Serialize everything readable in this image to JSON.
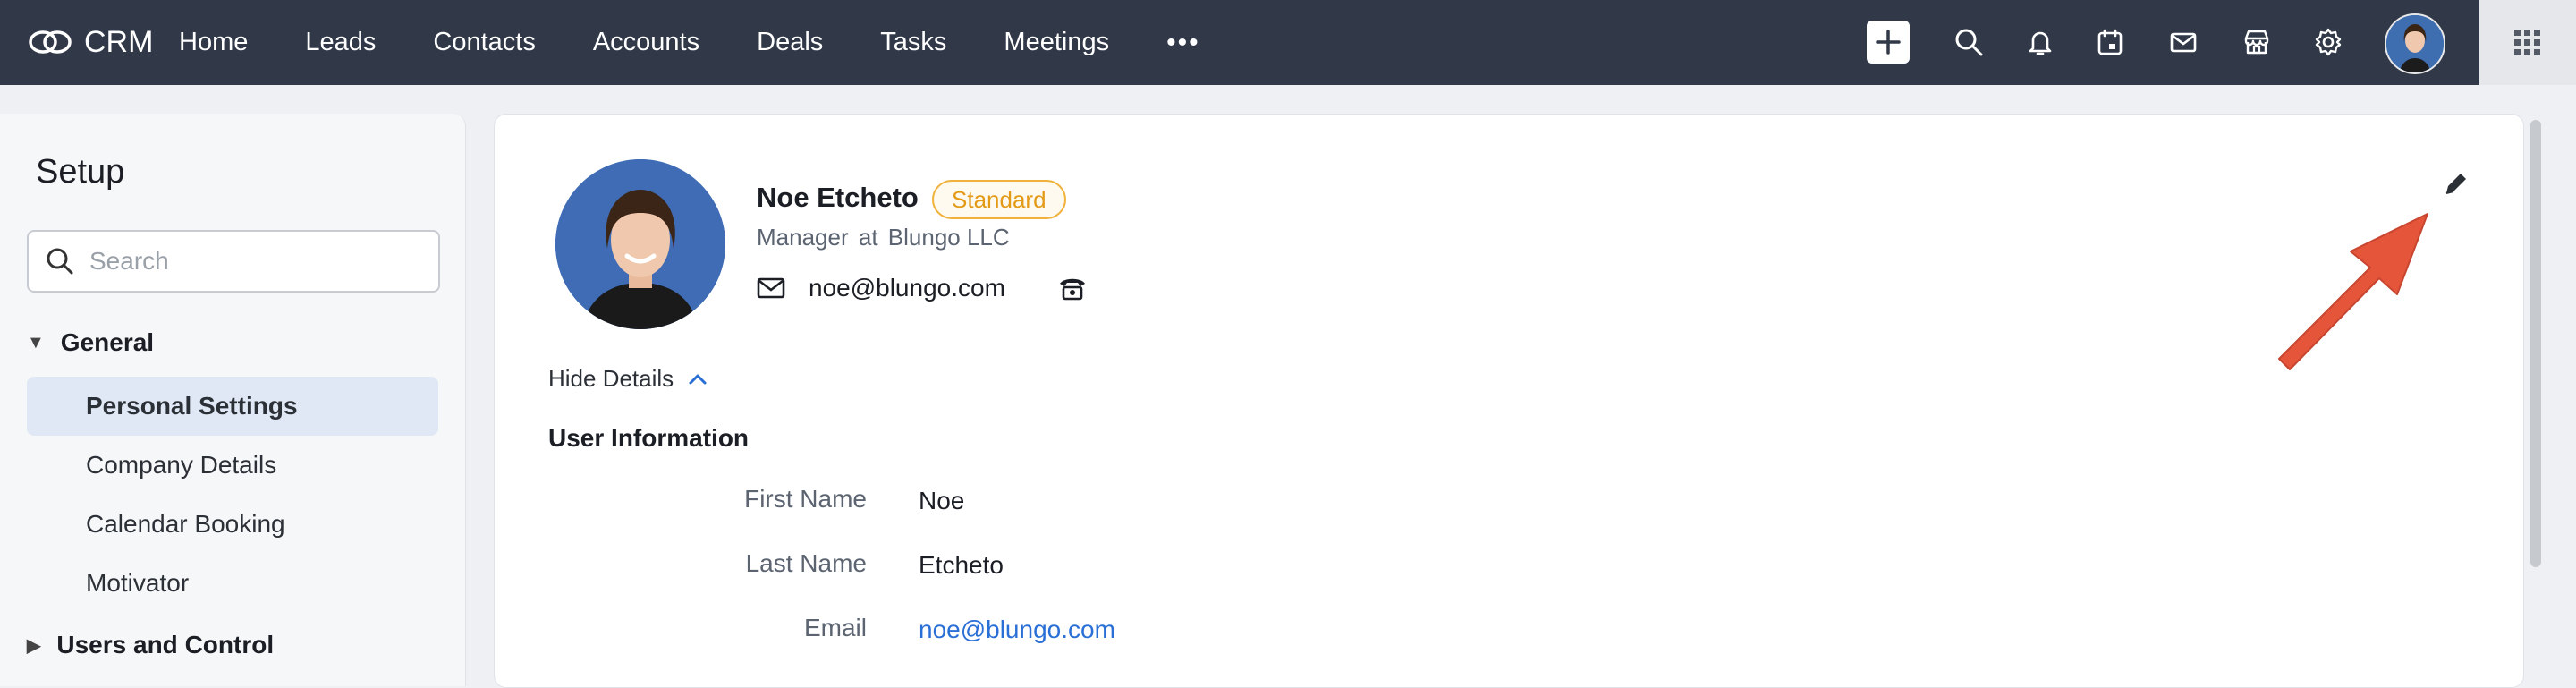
{
  "app": {
    "logo_text": "CRM"
  },
  "nav": {
    "items": [
      "Home",
      "Leads",
      "Contacts",
      "Accounts",
      "Deals",
      "Tasks",
      "Meetings"
    ],
    "more_label": "•••"
  },
  "topbar_icons": [
    "plus-icon",
    "search-icon",
    "bell-icon",
    "calendar-icon",
    "mail-icon",
    "marketplace-icon",
    "gear-icon",
    "avatar",
    "grid-icon"
  ],
  "sidebar": {
    "title": "Setup",
    "search_placeholder": "Search",
    "sections": [
      {
        "label": "General",
        "expanded": true,
        "items": [
          "Personal Settings",
          "Company Details",
          "Calendar Booking",
          "Motivator"
        ],
        "active": "Personal Settings"
      },
      {
        "label": "Users and Control",
        "expanded": false
      }
    ]
  },
  "profile": {
    "name": "Noe Etcheto",
    "badge": "Standard",
    "role": "Manager",
    "role_at": "at",
    "company": "Blungo LLC",
    "email": "noe@blungo.com",
    "hide_details_label": "Hide Details",
    "section_title": "User Information",
    "fields": [
      {
        "label": "First Name",
        "value": "Noe"
      },
      {
        "label": "Last Name",
        "value": "Etcheto"
      },
      {
        "label": "Email",
        "value": "noe@blungo.com"
      }
    ]
  },
  "colors": {
    "topbar": "#313949",
    "badge": "#e39a16",
    "link": "#2a6fd6",
    "arrow": "#e4553a"
  }
}
